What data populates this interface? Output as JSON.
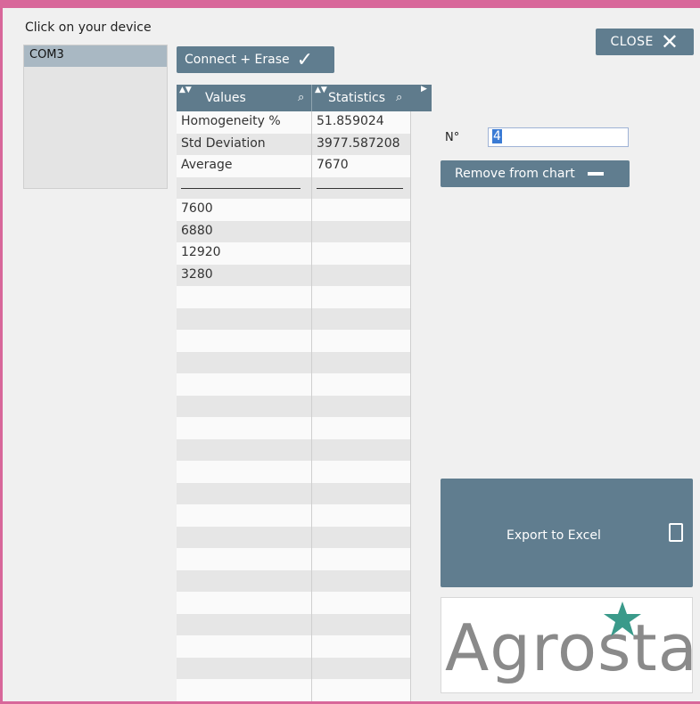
{
  "device_panel": {
    "title": "Click on your device",
    "items": [
      "COM3"
    ]
  },
  "toolbar": {
    "connect_label": "Connect + Erase",
    "close_label": "CLOSE"
  },
  "table": {
    "columns": [
      {
        "label": "Values"
      },
      {
        "label": "Statistics"
      }
    ],
    "rows": [
      [
        "Homogeneity %",
        "51.859024"
      ],
      [
        "Std Deviation",
        "3977.587208"
      ],
      [
        "Average",
        "7670"
      ],
      [
        "__line__",
        "__line__"
      ],
      [
        "7600",
        ""
      ],
      [
        "6880",
        ""
      ],
      [
        "12920",
        ""
      ],
      [
        "3280",
        ""
      ]
    ],
    "empty_rows": 19
  },
  "number_field": {
    "label": "N°",
    "value": "4"
  },
  "remove_button": {
    "label": "Remove from chart"
  },
  "export_button": {
    "label": "Export to Excel"
  },
  "logo": {
    "text": "Agrosta",
    "star_color": "#3a9a8a"
  },
  "colors": {
    "accent": "#607d8f",
    "frame": "#d8679a"
  }
}
